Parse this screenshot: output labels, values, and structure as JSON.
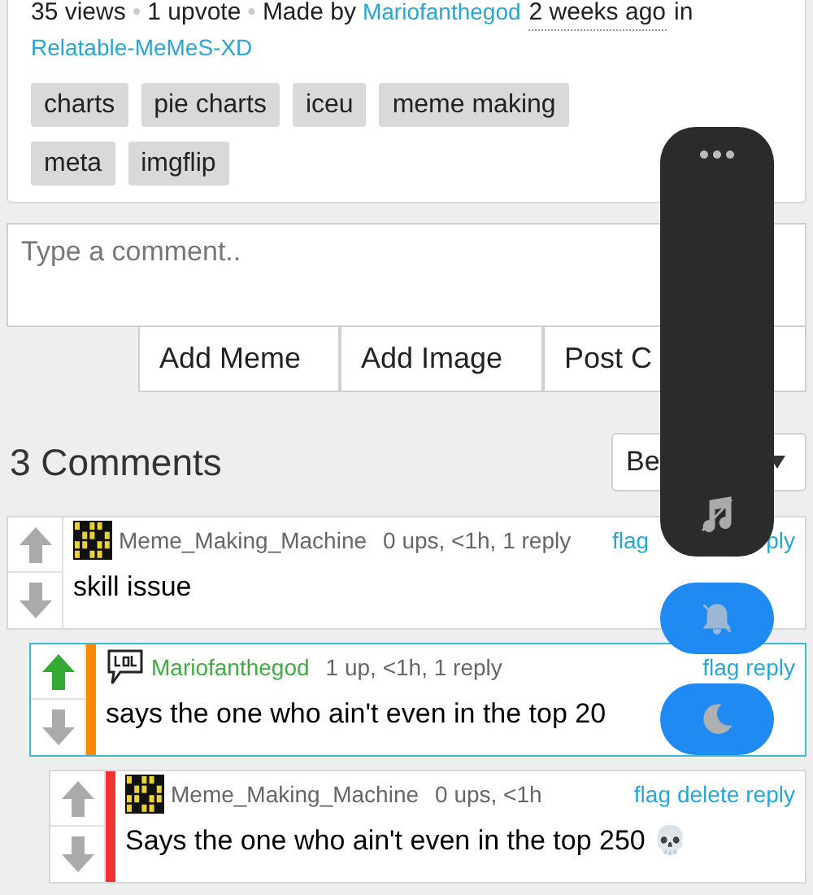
{
  "post_meta": [
    {
      "kind": "text",
      "text": "35 views"
    },
    {
      "kind": "separator",
      "text": "•"
    },
    {
      "kind": "text",
      "text": "1 upvote"
    },
    {
      "kind": "separator",
      "text": "•"
    },
    {
      "kind": "text",
      "text": "Made by"
    },
    {
      "kind": "link",
      "text": "Mariofanthegod"
    },
    {
      "kind": "time",
      "text": "2 weeks ago"
    },
    {
      "kind": "text",
      "text": "in"
    },
    {
      "kind": "link",
      "text": "Relatable-MeMeS-XD"
    }
  ],
  "tags": [
    "charts",
    "pie charts",
    "iceu",
    "meme making",
    "meta",
    "imgflip"
  ],
  "comment_box": {
    "placeholder": "Type a comment.."
  },
  "buttons": [
    "Add Meme",
    "Add Image",
    "Post C"
  ],
  "comments_header": {
    "count": "3 Comments",
    "sort": "Be"
  },
  "comments": [
    {
      "avatar": {
        "kind": "binary"
      },
      "user": {
        "name": "Meme_Making_Machine",
        "color": "#666666"
      },
      "stats": "0 ups, <1h, 1 reply",
      "actions": [
        "flag"
      ],
      "cut_action": "ply",
      "text": "skill issue",
      "upvoted": false,
      "highlighted": false,
      "children": [
        {
          "avatar": {
            "kind": "lol"
          },
          "user": {
            "name": "Mariofanthegod",
            "color": "#44aa44"
          },
          "stats": "1 up, <1h, 1 reply",
          "actions": [
            "flag",
            "reply"
          ],
          "text": "says the one who ain't even in the top 20",
          "upvoted": true,
          "highlighted": true,
          "color": "#ff8800",
          "children": [
            {
              "avatar": {
                "kind": "binary"
              },
              "user": {
                "name": "Meme_Making_Machine",
                "color": "#666666"
              },
              "stats": "0 ups, <1h",
              "actions": [
                "flag",
                "delete",
                "reply"
              ],
              "text": "Says the one who ain't even in the top 250 💀",
              "upvoted": false,
              "highlighted": false,
              "color": "#ee3333"
            }
          ]
        }
      ]
    }
  ],
  "quick_toggles": [
    {
      "kind": "mute",
      "on": true
    },
    {
      "kind": "night",
      "on": true
    }
  ]
}
